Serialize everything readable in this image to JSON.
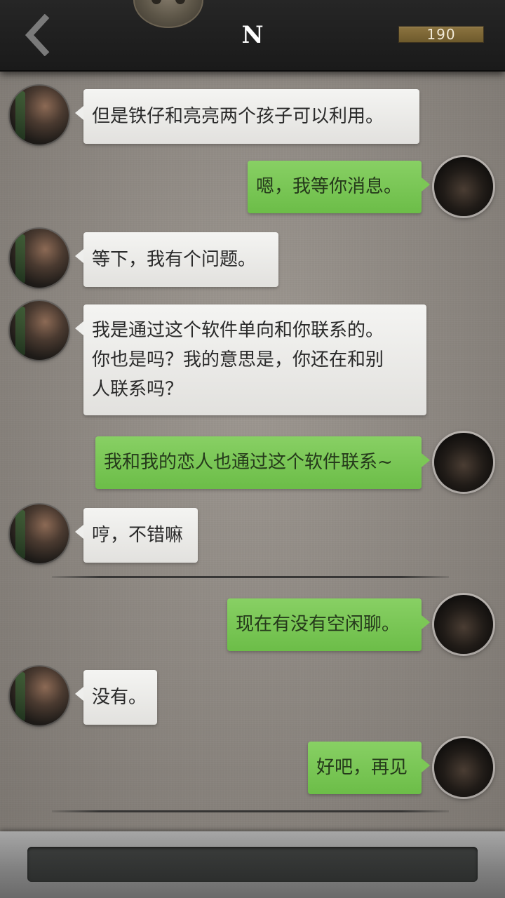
{
  "header": {
    "title": "N",
    "coins": "190",
    "back_icon": "chevron-left-icon"
  },
  "messages": [
    {
      "side": "in",
      "lines": [
        "但是铁仔和亮亮两个孩子可以利用。"
      ]
    },
    {
      "side": "out",
      "lines": [
        "嗯，我等你消息。"
      ]
    },
    {
      "side": "in",
      "lines": [
        "等下，我有个问题。"
      ]
    },
    {
      "side": "in",
      "lines": [
        "我是通过这个软件单向和你联系的。",
        "你也是吗？我的意思是，你还在和别",
        "人联系吗？"
      ]
    },
    {
      "side": "out",
      "lines": [
        "我和我的恋人也通过这个软件联系~"
      ]
    },
    {
      "side": "in",
      "lines": [
        "哼，不错嘛"
      ]
    },
    {
      "side": "out",
      "lines": [
        "现在有没有空闲聊。"
      ]
    },
    {
      "side": "in",
      "lines": [
        "没有。"
      ]
    },
    {
      "side": "out",
      "lines": [
        "好吧，再见"
      ]
    }
  ],
  "colors": {
    "incoming_bubble": "#eeeeec",
    "outgoing_bubble": "#7cc756",
    "background": "#9e9891",
    "header": "#1f1f1f"
  }
}
